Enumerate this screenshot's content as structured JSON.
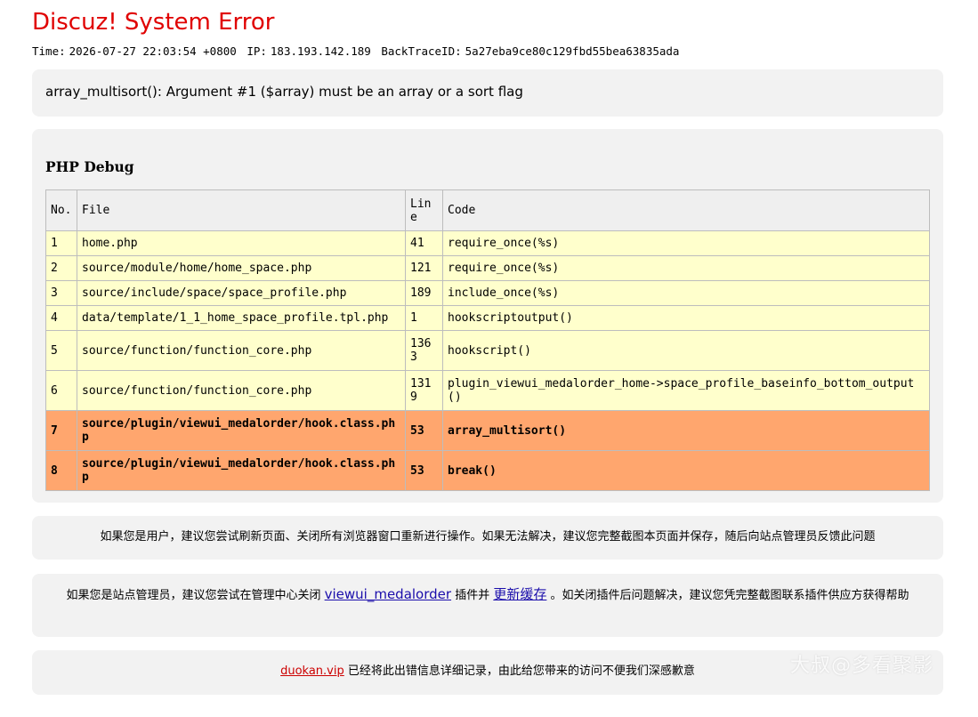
{
  "title": "Discuz! System Error",
  "meta": {
    "time_label": "Time:",
    "time_value": "2026-07-27 22:03:54 +0800",
    "ip_label": "IP:",
    "ip_value": "183.193.142.189",
    "backtrace_label": "BackTraceID:",
    "backtrace_value": "5a27eba9ce80c129fbd55bea63835ada"
  },
  "error_message": "array_multisort(): Argument #1 ($array) must be an array or a sort flag",
  "debug": {
    "heading": "PHP Debug",
    "columns": [
      "No.",
      "File",
      "Line",
      "Code"
    ],
    "rows": [
      {
        "no": "1",
        "file": "home.php",
        "line": "41",
        "code": "require_once(%s)"
      },
      {
        "no": "2",
        "file": "source/module/home/home_space.php",
        "line": "121",
        "code": "require_once(%s)"
      },
      {
        "no": "3",
        "file": "source/include/space/space_profile.php",
        "line": "189",
        "code": "include_once(%s)"
      },
      {
        "no": "4",
        "file": "data/template/1_1_home_space_profile.tpl.php",
        "line": "1",
        "code": "hookscriptoutput()"
      },
      {
        "no": "5",
        "file": "source/function/function_core.php",
        "line": "1363",
        "code": "hookscript()"
      },
      {
        "no": "6",
        "file": "source/function/function_core.php",
        "line": "1319",
        "code": "plugin_viewui_medalorder_home->space_profile_baseinfo_bottom_output()"
      },
      {
        "no": "7",
        "file": "source/plugin/viewui_medalorder/hook.class.php",
        "line": "53",
        "code": "array_multisort()"
      },
      {
        "no": "8",
        "file": "source/plugin/viewui_medalorder/hook.class.php",
        "line": "53",
        "code": "break()"
      }
    ]
  },
  "tip_user": "如果您是用户，建议您尝试刷新页面、关闭所有浏览器窗口重新进行操作。如果无法解决，建议您完整截图本页面并保存，随后向站点管理员反馈此问题",
  "tip_admin": {
    "prefix": "如果您是站点管理员，建议您尝试在管理中心关闭",
    "plugin_link": "viewui_medalorder",
    "middle": "插件并",
    "cache_link": "更新缓存",
    "suffix": "。如关闭插件后问题解决，建议您凭完整截图联系插件供应方获得帮助"
  },
  "footer": {
    "site_link": "duokan.vip",
    "text": "已经将此出错信息详细记录，由此给您带来的访问不便我们深感歉意"
  },
  "watermark": "大叔@多看聚影"
}
